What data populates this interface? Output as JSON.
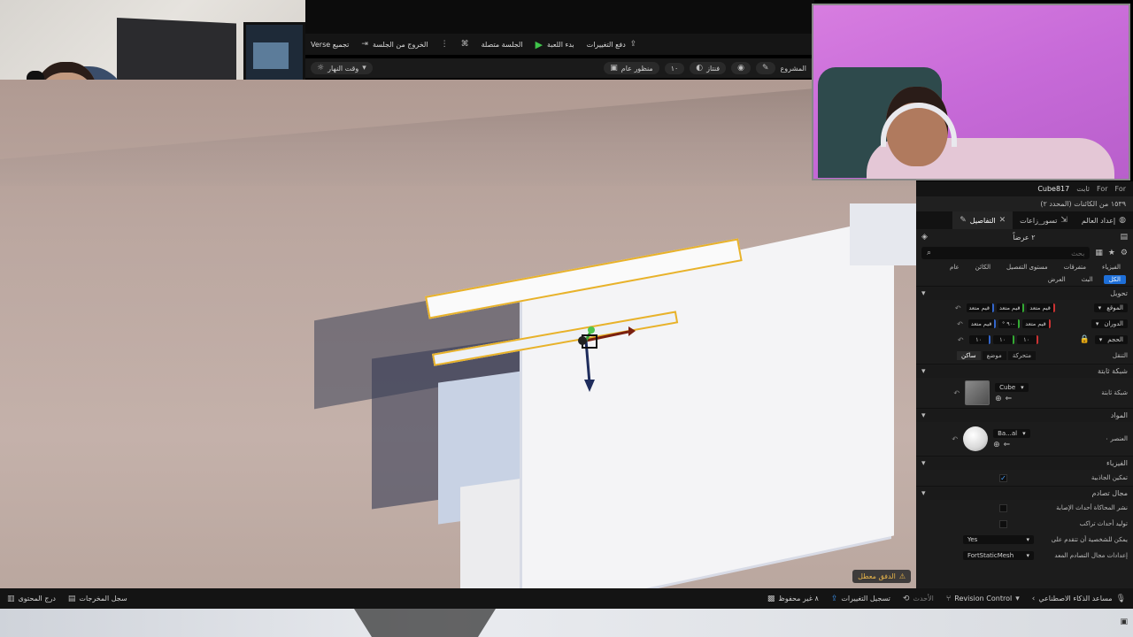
{
  "toolbar": {
    "verse_build": "تجميع Verse",
    "exit_session": "الخروج من الجلسة",
    "session_connected": "الجلسة متصلة",
    "start_game": "بدء اللعبة",
    "push_changes": "دفع التغييرات",
    "time_of_day": "وقت النهار",
    "project": "المشروع",
    "perspective": "منظور عام",
    "lit": "فنتاز",
    "speed": "١٠"
  },
  "viewport": {
    "warning": "الدفق معطل"
  },
  "panel": {
    "actor_name": "Cube817",
    "header_extra": "ثابت",
    "header_for1": "For",
    "header_for2": "For",
    "selection_info": "١٥٣٩ من الكائنات (المحدد ٢)",
    "tabs": [
      {
        "label": "إعداد العالم"
      },
      {
        "label": "تسور_زاعات"
      },
      {
        "label": "التفاصيل"
      }
    ],
    "count": "٢ عرضاً",
    "search_placeholder": "بحث",
    "filters": [
      "الفيزياء",
      "متفرقات",
      "مستوى التفصيل",
      "الكائن",
      "عام",
      "الكل",
      "البث",
      "العرض"
    ],
    "active_filter": "الكل",
    "sections": {
      "transform": "تحويل",
      "static_mesh": "شبكة ثابتة",
      "materials": "المواد",
      "physics": "الفيزياء",
      "collision": "مجال تصادم"
    },
    "transform": {
      "location_label": "الموقع",
      "rotation_label": "الدوران",
      "scale_label": "الحجم",
      "mobility_label": "التنقل",
      "multiple": "قيم متعد",
      "rot_mid": "-٩٠ °",
      "scale_vals": [
        "١٠",
        "١٠",
        "١٠"
      ],
      "mobility": [
        "متحركة",
        "موضع",
        "ساكن"
      ]
    },
    "static_mesh": {
      "label": "شبكة ثابتة",
      "value": "Cube"
    },
    "material": {
      "label": "العنصر ٠",
      "value": "Ba...al"
    },
    "physics": {
      "gravity_label": "تمكين الجاذبية",
      "gravity_checked": true
    },
    "collision": {
      "sim_hits_label": "نشر المحاكاة أحداث الإصابة",
      "overlap_label": "توليد أحداث تراكب",
      "step_up_label": "يمكن للشخصية أن تتقدم على",
      "step_up_value": "Yes",
      "presets_label": "إعدادات مجال التصادم المعد",
      "presets_value": "FortStaticMesh"
    }
  },
  "bottombar": {
    "content_drawer": "درج المحتوى",
    "output_log": "سجل المخرجات",
    "unsaved": "٨ غير محفوظ",
    "submit_changes": "تسجيل التغييرات",
    "latest": "الأحدث",
    "revision_control": "Revision Control",
    "ai_assistant": "مساعد الذكاء الاصطناعي"
  },
  "colors": {
    "selection_outline": "#e8b22a",
    "active_filter": "#1e6fd8",
    "play_green": "#3fc44a"
  }
}
